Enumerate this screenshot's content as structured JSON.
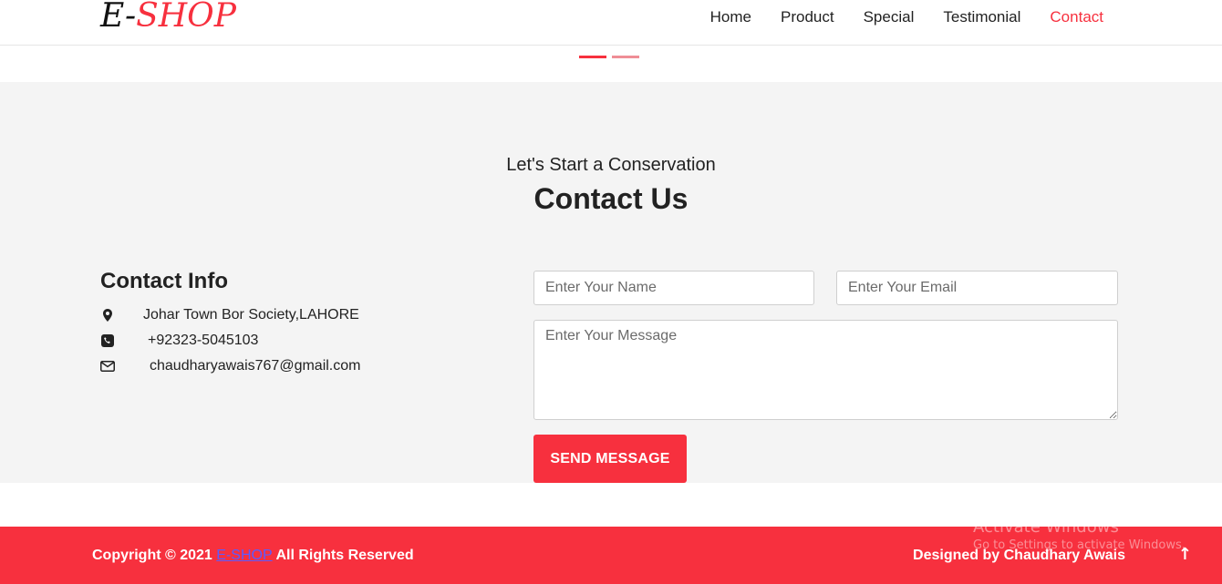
{
  "header": {
    "logo_prefix": "E-",
    "logo_accent": "SHOP",
    "nav": [
      {
        "label": "Home"
      },
      {
        "label": "Product"
      },
      {
        "label": "Special"
      },
      {
        "label": "Testimonial"
      },
      {
        "label": "Contact",
        "active": true
      }
    ]
  },
  "contact": {
    "pre_title": "Let's Start a Conservation",
    "title": "Contact Us",
    "info_heading": "Contact Info",
    "address": "Johar Town Bor Society,LAHORE",
    "phone": "+92323-5045103",
    "email": "chaudharyawais767@gmail.com",
    "form": {
      "name_placeholder": "Enter Your Name",
      "email_placeholder": "Enter Your Email",
      "message_placeholder": "Enter Your Message",
      "submit_label": "SEND MESSAGE"
    }
  },
  "footer": {
    "copyright_prefix": "Copyright © 2021 ",
    "brand": "E-SHOP",
    "copyright_suffix": " All Rights Reserved",
    "designed_by": "Designed by Chaudhary Awais",
    "scroll_top_icon": "arrow-up-icon"
  },
  "watermark": {
    "line1": "Activate Windows",
    "line2": "Go to Settings to activate Windows."
  },
  "colors": {
    "accent": "#f7303e",
    "section_bg": "#f4f4f4",
    "brand_link": "#5b5bff"
  }
}
